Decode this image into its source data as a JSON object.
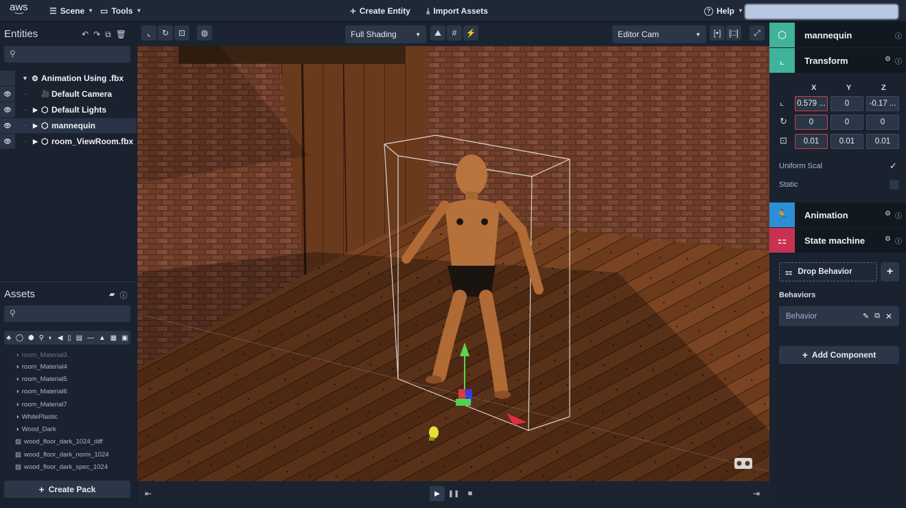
{
  "topbar": {
    "logo": "aws",
    "menu_scene": "Scene",
    "menu_tools": "Tools",
    "create_entity": "Create Entity",
    "import_assets": "Import Assets",
    "help": "Help"
  },
  "entities": {
    "title": "Entities",
    "search_placeholder": "",
    "tree": [
      {
        "label": "Animation Using .fbx",
        "level": 0,
        "selected": false
      },
      {
        "label": "Default Camera",
        "level": 1,
        "selected": false
      },
      {
        "label": "Default Lights",
        "level": 1,
        "selected": false
      },
      {
        "label": "mannequin",
        "level": 1,
        "selected": true
      },
      {
        "label": "room_ViewRoom.fbx",
        "level": 1,
        "selected": false
      }
    ]
  },
  "assets": {
    "title": "Assets",
    "search_placeholder": "",
    "items": [
      {
        "label": "room_Material3",
        "icon": "material-icon"
      },
      {
        "label": "room_Material4",
        "icon": "material-icon"
      },
      {
        "label": "room_Material5",
        "icon": "material-icon"
      },
      {
        "label": "room_Material6",
        "icon": "material-icon"
      },
      {
        "label": "room_Material7",
        "icon": "material-icon"
      },
      {
        "label": "WhitePlastic",
        "icon": "material-icon"
      },
      {
        "label": "Wood_Dark",
        "icon": "material-icon"
      },
      {
        "label": "wood_floor_dark_1024_diff",
        "icon": "texture-icon"
      },
      {
        "label": "wood_floor_dark_norm_1024",
        "icon": "texture-icon"
      },
      {
        "label": "wood_floor_dark_spec_1024",
        "icon": "texture-icon"
      }
    ],
    "create_pack": "Create Pack"
  },
  "viewport": {
    "shading": "Full Shading",
    "camera": "Editor Cam"
  },
  "inspector": {
    "entity_name": "mannequin",
    "transform": {
      "title": "Transform",
      "axes": [
        "X",
        "Y",
        "Z"
      ],
      "position": [
        "0.579 ...",
        "0",
        "-0.17 ..."
      ],
      "rotation": [
        "0",
        "0",
        "0"
      ],
      "scale": [
        "0.01",
        "0.01",
        "0.01"
      ],
      "uniform_scale_label": "Uniform Scal",
      "uniform_scale_checked": true,
      "static_label": "Static",
      "static_checked": false
    },
    "animation_title": "Animation",
    "state_machine_title": "State machine",
    "drop_behavior": "Drop Behavior",
    "behaviors_label": "Behaviors",
    "behavior_item": "Behavior",
    "add_component": "Add Component"
  },
  "colors": {
    "accent_teal": "#3fb39b",
    "accent_blue": "#2b8fd6",
    "accent_red": "#c8314f"
  }
}
